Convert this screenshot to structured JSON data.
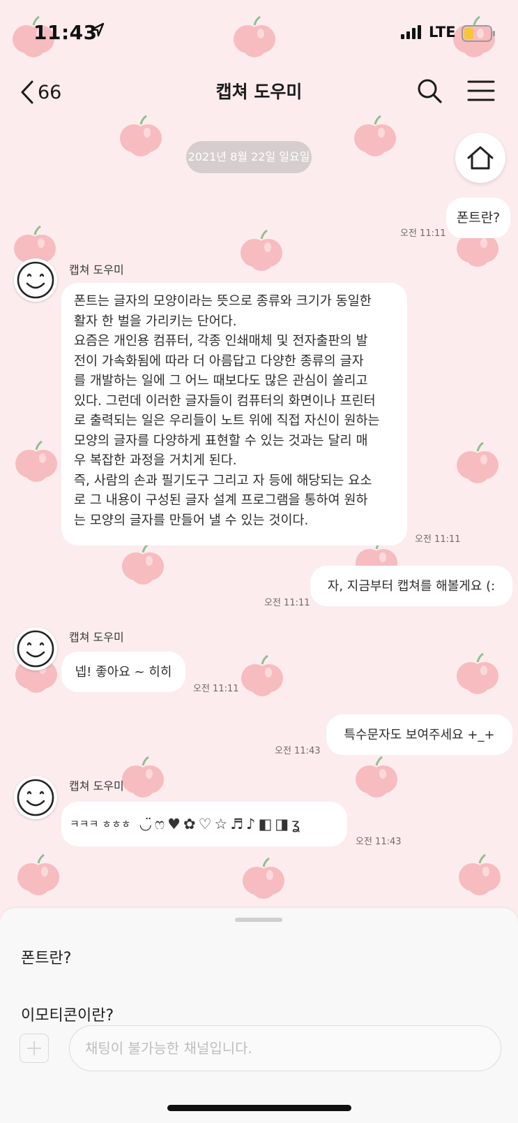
{
  "status_bar": {
    "time": "11:43",
    "network": "LTE"
  },
  "header": {
    "back_count": "66",
    "title": "캡쳐 도우미"
  },
  "date_divider": "2021년 8월 22일 일요일",
  "messages": [
    {
      "from": "me",
      "text": "폰트란?",
      "time": "오전 11:11"
    },
    {
      "from": "bot",
      "sender": "캡쳐 도우미",
      "lines": [
        "폰트는 글자의 모양이라는 뜻으로 종류와 크기가 동일한",
        "활자 한 벌을 가리키는 단어다.",
        "요즘은 개인용 컴퓨터, 각종 인쇄매체 및 전자출판의 발",
        "전이 가속화됨에 따라 더 아름답고 다양한 종류의 글자",
        "를 개발하는 일에 그 어느 때보다도 많은 관심이 쏠리고",
        "있다. 그런데 이러한 글자들이 컴퓨터의 화면이나 프린터",
        "로 출력되는 일은 우리들이 노트 위에 직접 자신이 원하는",
        "모양의 글자를 다양하게 표현할 수 있는 것과는 달리 매",
        "우 복잡한 과정을 거치게 된다.",
        "즉, 사람의 손과 필기도구 그리고 자 등에 해당되는 요소",
        "로 그 내용이 구성된 글자 설계 프로그램을 통하여 원하",
        "는 모양의 글자를 만들어 낼 수 있는 것이다."
      ],
      "time": "오전 11:11"
    },
    {
      "from": "me",
      "text": "자, 지금부터 캡쳐를 해볼게요 (:",
      "time": "오전 11:11"
    },
    {
      "from": "bot",
      "sender": "캡쳐 도우미",
      "text": "넵! 좋아요 ~ 히히",
      "time": "오전 11:11"
    },
    {
      "from": "me",
      "text": "특수문자도 보여주세요 +_+",
      "time": "오전 11:43"
    },
    {
      "from": "bot",
      "sender": "캡쳐 도우미",
      "prefix": "ㅋㅋㅋ ㅎㅎㅎ",
      "symbols": [
        "◡̈",
        "ෆ",
        "♥",
        "✿",
        "♡",
        "☆",
        "♬",
        "♪",
        "◧",
        "◨",
        "ʓ"
      ],
      "time": "오전 11:43"
    }
  ],
  "bottom": {
    "quick_replies": [
      "폰트란?",
      "이모티콘이란?"
    ],
    "input_placeholder": "채팅이 불가능한 채널입니다."
  },
  "icons": [
    "location-arrow-icon",
    "signal-icon",
    "battery-icon",
    "back-chevron-icon",
    "search-icon",
    "menu-icon",
    "home-icon",
    "smiley-avatar-icon",
    "plus-icon"
  ],
  "colors": {
    "background": "#fcecee",
    "bubble": "#ffffff",
    "date_pill": "#d6cdce",
    "battery": "#f5c53a"
  }
}
